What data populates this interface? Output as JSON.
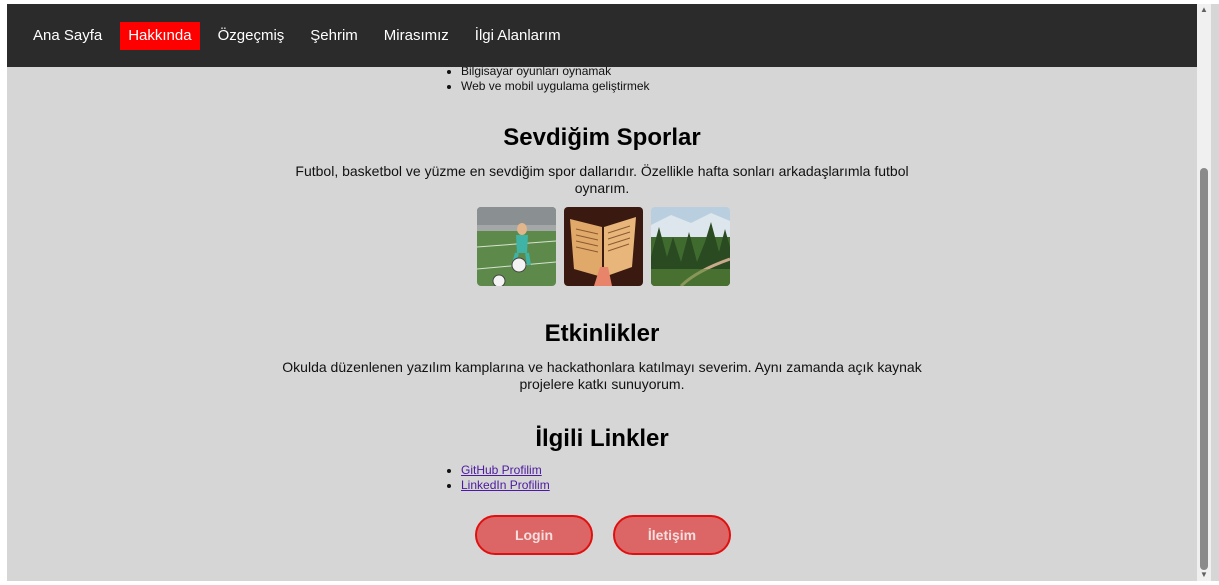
{
  "nav": {
    "items": [
      {
        "label": "Ana Sayfa",
        "active": false
      },
      {
        "label": "Hakkında",
        "active": true
      },
      {
        "label": "Özgeçmiş",
        "active": false
      },
      {
        "label": "Şehrim",
        "active": false
      },
      {
        "label": "Mirasımız",
        "active": false
      },
      {
        "label": "İlgi Alanlarım",
        "active": false
      }
    ],
    "active_color": "#ff0000",
    "bg_color": "#2b2b2b"
  },
  "hobbies": {
    "items": [
      "Bilgisayar oyunları oynamak",
      "Web ve mobil uygulama geliştirmek"
    ]
  },
  "sports": {
    "title": "Sevdiğim Sporlar",
    "text": "Futbol, basketbol ve yüzme en sevdiğim spor dallarıdır. Özellikle hafta sonları arkadaşlarımla futbol oynarım.",
    "images": [
      "football-photo",
      "book-photo",
      "forest-photo"
    ]
  },
  "activities": {
    "title": "Etkinlikler",
    "text": "Okulda düzenlenen yazılım kamplarına ve hackathonlara katılmayı severim. Aynı zamanda açık kaynak projelere katkı sunuyorum."
  },
  "links": {
    "title": "İlgili Linkler",
    "items": [
      "GitHub Profilim",
      "LinkedIn Profilim"
    ]
  },
  "buttons": {
    "login": "Login",
    "contact": "İletişim"
  }
}
